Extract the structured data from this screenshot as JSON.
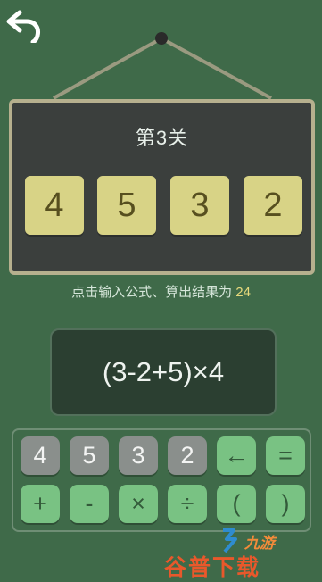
{
  "level": {
    "title": "第3关"
  },
  "cards": [
    "4",
    "5",
    "3",
    "2"
  ],
  "hint": {
    "prefix": "点击输入公式、算出结果为 ",
    "target": "24"
  },
  "expression": "(3-2+5)×4",
  "keypad": {
    "row1": [
      {
        "label": "4",
        "kind": "num"
      },
      {
        "label": "5",
        "kind": "num"
      },
      {
        "label": "3",
        "kind": "num"
      },
      {
        "label": "2",
        "kind": "num"
      },
      {
        "label": "←",
        "kind": "op"
      },
      {
        "label": "=",
        "kind": "op"
      }
    ],
    "row2": [
      {
        "label": "+",
        "kind": "op"
      },
      {
        "label": "-",
        "kind": "op"
      },
      {
        "label": "×",
        "kind": "op"
      },
      {
        "label": "÷",
        "kind": "op"
      },
      {
        "label": "(",
        "kind": "op"
      },
      {
        "label": ")",
        "kind": "op"
      }
    ]
  },
  "watermark": {
    "text": "谷普下载",
    "small": "九游"
  },
  "colors": {
    "background": "#3f6a49",
    "board": "#3b3f3d",
    "card": "#d8d386",
    "target": "#e7d97c",
    "key_num": "#8a8f8c",
    "key_op": "#79c283"
  },
  "icons": {
    "back": "back-arrow-icon"
  }
}
